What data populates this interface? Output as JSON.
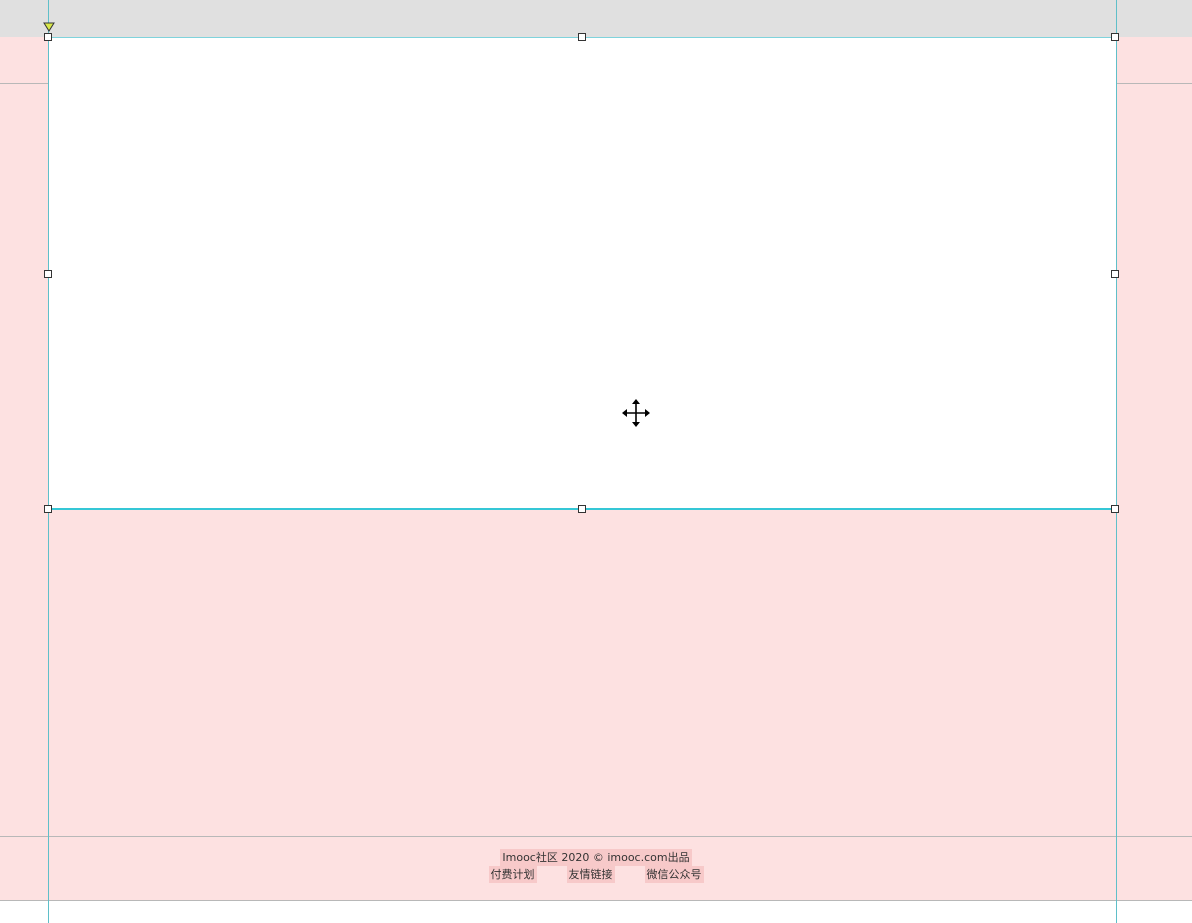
{
  "canvas": {
    "colors": {
      "page_background": "#fde1e1",
      "top_band": "#e0e0e0",
      "guide": "#5fbfc9",
      "selection_border": "#35c7d6",
      "text_highlight": "#f7c9c9"
    }
  },
  "selection": {
    "icons": {
      "handle": "transform-handle",
      "origin": "origin-marker-icon",
      "cursor": "move-cursor-icon"
    }
  },
  "footer": {
    "copyright": "Imooc社区 2020 © imooc.com出品",
    "links": [
      "付费计划",
      "友情链接",
      "微信公众号"
    ]
  }
}
